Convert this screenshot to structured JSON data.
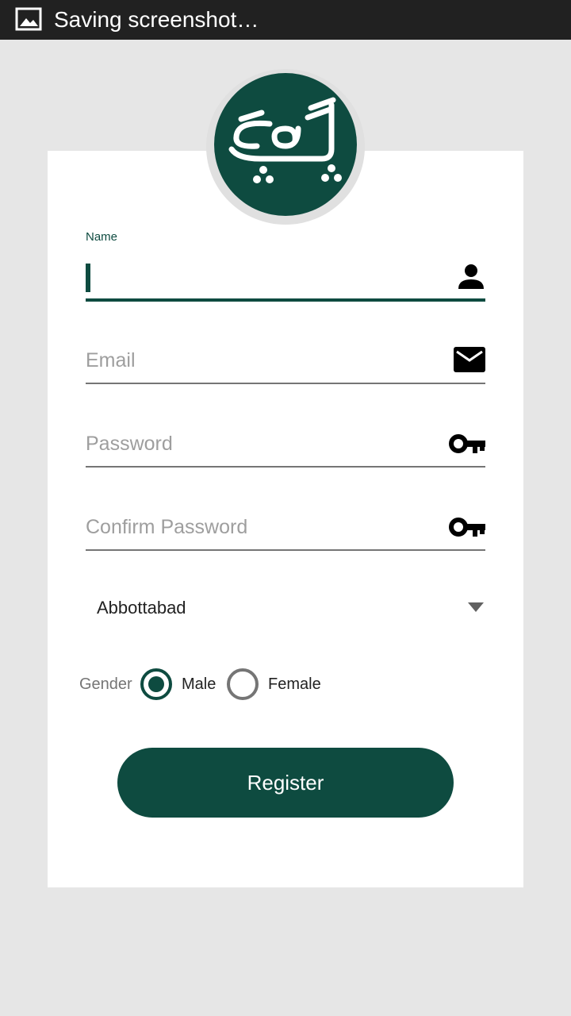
{
  "status_bar": {
    "text": "Saving screenshot…",
    "icon": "image-icon"
  },
  "logo": {
    "text": "پوکی",
    "background": "#0e4b40"
  },
  "form": {
    "name": {
      "label": "Name",
      "value": "",
      "icon": "person-icon"
    },
    "email": {
      "placeholder": "Email",
      "icon": "mail-icon"
    },
    "password": {
      "placeholder": "Password",
      "icon": "key-icon"
    },
    "confirm_password": {
      "placeholder": "Confirm Password",
      "icon": "key-icon"
    },
    "city": {
      "selected": "Abbottabad"
    },
    "gender": {
      "label": "Gender",
      "options": [
        {
          "label": "Male",
          "checked": true
        },
        {
          "label": "Female",
          "checked": false
        }
      ]
    },
    "register_label": "Register"
  },
  "colors": {
    "accent": "#0e4b40",
    "status_bar": "#212121",
    "background": "#e6e6e6",
    "card": "#ffffff",
    "hint_text": "#9e9e9e"
  }
}
